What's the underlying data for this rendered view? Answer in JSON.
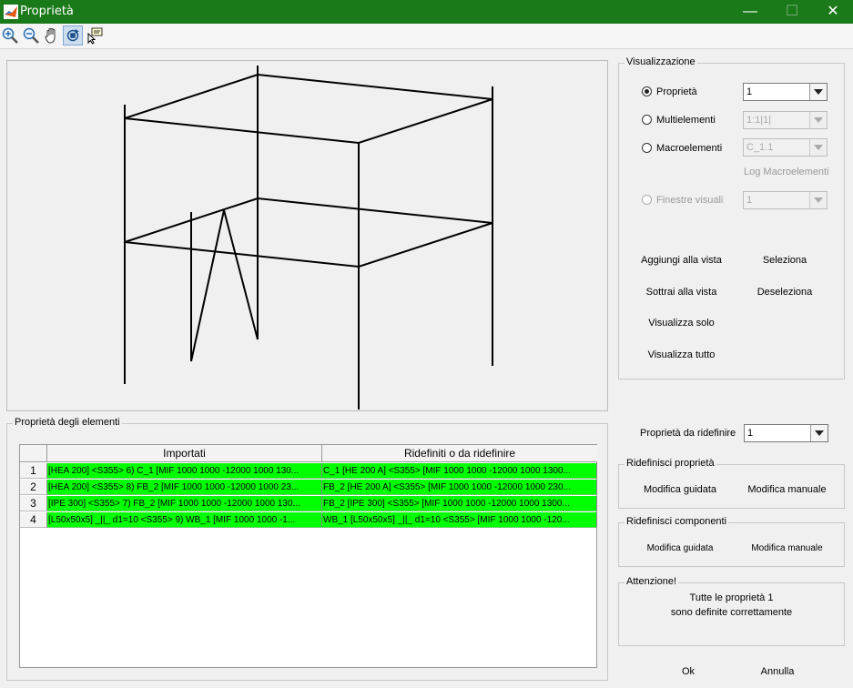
{
  "window": {
    "title": "Proprietà",
    "minimize": "—",
    "maximize": "☐",
    "close": "✕"
  },
  "toolbar": {
    "icons": [
      "zoom-in-icon",
      "zoom-out-icon",
      "pan-hand-icon",
      "rotate-3d-icon",
      "data-cursor-icon"
    ]
  },
  "visualizzazione": {
    "legend": "Visualizzazione",
    "proprieta": {
      "label": "Proprietà",
      "value": "1"
    },
    "multielementi": {
      "label": "Multielementi",
      "value": "1:1|1|"
    },
    "macroelementi": {
      "label": "Macroelementi",
      "value": "C_1.1"
    },
    "log_macro": "Log Macroelementi",
    "finestre": {
      "label": "Finestre visuali",
      "value": "1"
    },
    "aggiungi": "Aggiungi alla vista",
    "seleziona": "Seleziona",
    "sottrai": "Sottrai alla vista",
    "deseleziona": "Deseleziona",
    "visualizza_solo": "Visualizza solo",
    "visualizza_tutto": "Visualizza tutto"
  },
  "elementi": {
    "legend": "Proprietà degli elementi",
    "columns": [
      "Importati",
      "Ridefiniti o da ridefinire"
    ],
    "rows": [
      {
        "n": "1",
        "imp": "[HEA 200] <S355> 6) C_1  [MIF 1000 1000 -12000 1000 130...",
        "rid": "C_1  [HE 200 A]  <S355>  [MIF 1000 1000 -12000 1000 1300..."
      },
      {
        "n": "2",
        "imp": "[HEA 200] <S355> 8) FB_2   [MIF 1000 1000 -12000 1000 23...",
        "rid": "FB_2  [HE 200 A]  <S355>  [MIF 1000 1000 -12000 1000 230..."
      },
      {
        "n": "3",
        "imp": "[IPE 300] <S355> 7) FB_2   [MIF 1000 1000 -12000 1000 130...",
        "rid": "FB_2  [IPE 300]  <S355>  [MIF 1000 1000 -12000 1000 1300..."
      },
      {
        "n": "4",
        "imp": "[L50x50x5]  _||_ d1=10 <S355> 9) WB_1   [MIF 1000 1000 -1...",
        "rid": "WB_1  [L50x50x5]  _||_ d1=10 <S355>  [MIF 1000 1000 -120..."
      }
    ],
    "row_color": "#00ff00"
  },
  "ridefinire": {
    "label": "Proprietà da ridefinire",
    "value": "1"
  },
  "ridefinisci_proprieta": {
    "legend": "Ridefinisci proprietà",
    "guidata": "Modifica guidata",
    "manuale": "Modifica manuale"
  },
  "ridefinisci_componenti": {
    "legend": "Ridefinisci componenti",
    "guidata": "Modifica guidata",
    "manuale": "Modifica manuale"
  },
  "attenzione": {
    "legend": "Attenzione!",
    "line1": "Tutte le proprietà 1",
    "line2": "sono definite correttamente"
  },
  "footer": {
    "ok": "Ok",
    "annulla": "Annulla"
  }
}
